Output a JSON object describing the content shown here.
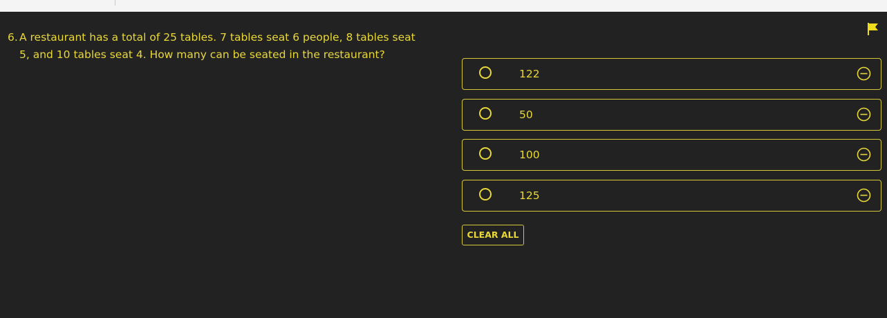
{
  "question": {
    "number": "6.",
    "text": "A restaurant has a total of 25 tables. 7 tables seat 6 people, 8 tables seat 5, and 10 tables seat 4. How many can be seated in the restaurant?"
  },
  "options": [
    {
      "label": "122"
    },
    {
      "label": "50"
    },
    {
      "label": "100"
    },
    {
      "label": "125"
    }
  ],
  "clear_label": "CLEAR ALL",
  "icons": {
    "flag": "flag-icon",
    "radio": "radio-circle-icon",
    "eliminate": "minus-circle-icon"
  },
  "colors": {
    "background": "#222222",
    "accent": "#e8d83a",
    "topbar": "#f4f4f4"
  }
}
